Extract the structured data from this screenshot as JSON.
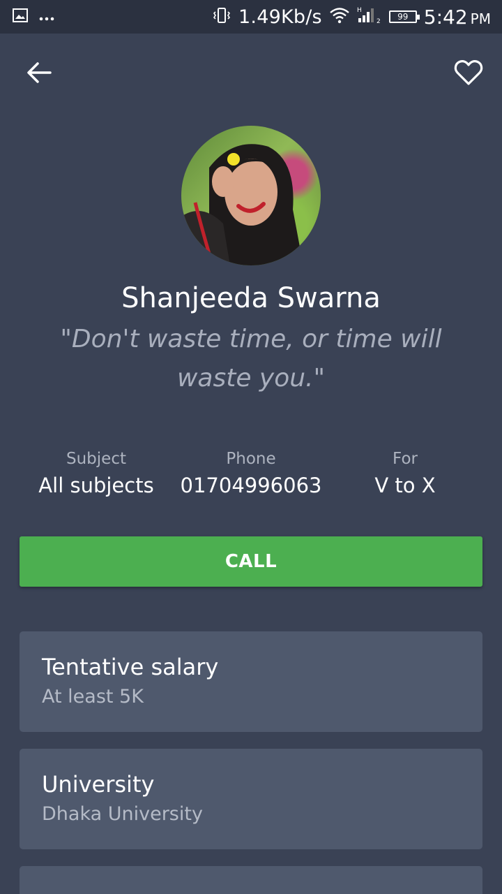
{
  "status_bar": {
    "speed": "1.49Kb/s",
    "battery": "99",
    "time": "5:42",
    "ampm": "PM",
    "icons": [
      "image-icon",
      "more-dots-icon",
      "vibrate-icon",
      "wifi-icon",
      "signal-icon",
      "battery-icon"
    ]
  },
  "header": {
    "back_icon": "back-arrow-icon",
    "favorite_icon": "heart-outline-icon"
  },
  "profile": {
    "name": "Shanjeeda Swarna",
    "quote": "\"Don't waste time, or time will waste you.\""
  },
  "details": [
    {
      "label": "Subject",
      "value": "All subjects"
    },
    {
      "label": "Phone",
      "value": "01704996063"
    },
    {
      "label": "For",
      "value": "V to X"
    }
  ],
  "call_button": {
    "label": "CALL",
    "color": "#4caf50"
  },
  "cards": [
    {
      "title": "Tentative salary",
      "value": "At least 5K"
    },
    {
      "title": "University",
      "value": "Dhaka University"
    }
  ],
  "colors": {
    "background": "#3a4255",
    "card": "#4f596d",
    "status_bar": "#2b3140"
  }
}
